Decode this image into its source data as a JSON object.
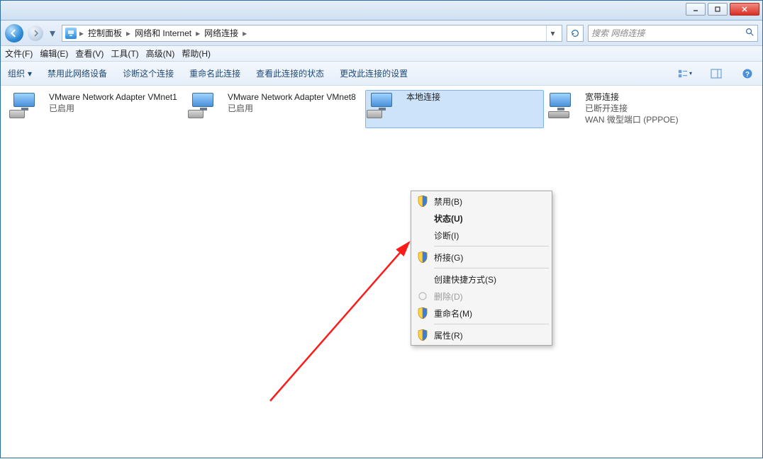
{
  "breadcrumb": {
    "items": [
      "控制面板",
      "网络和 Internet",
      "网络连接"
    ]
  },
  "search": {
    "placeholder": "搜索 网络连接"
  },
  "menubar": [
    "文件(F)",
    "编辑(E)",
    "查看(V)",
    "工具(T)",
    "高级(N)",
    "帮助(H)"
  ],
  "toolbar": {
    "organize": "组织",
    "actions": [
      "禁用此网络设备",
      "诊断这个连接",
      "重命名此连接",
      "查看此连接的状态",
      "更改此连接的设置"
    ]
  },
  "connections": [
    {
      "name": "VMware Network Adapter VMnet1",
      "status": "已启用",
      "detail": "",
      "icon": "nic",
      "selected": false
    },
    {
      "name": "VMware Network Adapter VMnet8",
      "status": "已启用",
      "detail": "",
      "icon": "nic",
      "selected": false
    },
    {
      "name": "本地连接",
      "status": "",
      "detail": "",
      "icon": "nic",
      "selected": true
    },
    {
      "name": "宽带连接",
      "status": "已断开连接",
      "detail": "WAN 微型端口 (PPPOE)",
      "icon": "modem",
      "selected": false
    }
  ],
  "context_menu": {
    "items": [
      {
        "label": "禁用(B)",
        "icon": "shield",
        "bold": false
      },
      {
        "label": "状态(U)",
        "icon": "",
        "bold": true
      },
      {
        "label": "诊断(I)",
        "icon": "",
        "bold": false
      },
      {
        "sep": true
      },
      {
        "label": "桥接(G)",
        "icon": "shield",
        "bold": false
      },
      {
        "sep": true
      },
      {
        "label": "创建快捷方式(S)",
        "icon": "",
        "bold": false
      },
      {
        "label": "删除(D)",
        "icon": "link",
        "bold": false,
        "disabled": true
      },
      {
        "label": "重命名(M)",
        "icon": "shield",
        "bold": false
      },
      {
        "sep": true
      },
      {
        "label": "属性(R)",
        "icon": "shield",
        "bold": false
      }
    ]
  }
}
